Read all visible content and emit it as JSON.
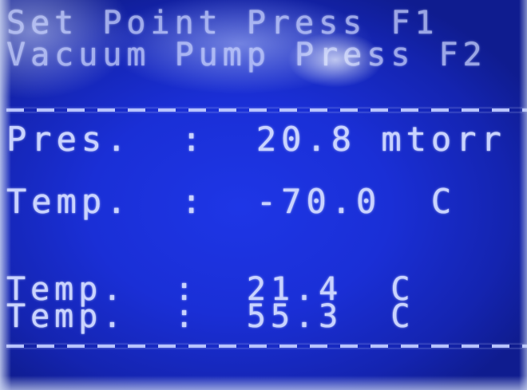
{
  "display": {
    "lines": [
      "Set Point Press F1",
      "Vacuum Pump Press F2"
    ],
    "pressure": {
      "label": "Pres.",
      "separator": ":",
      "value": "20.8",
      "unit": "mtorr"
    },
    "temp_1": {
      "label": "Temp.",
      "separator": ":",
      "value": "-70.0",
      "unit": "C"
    },
    "temp_2": {
      "label": "Temp.",
      "separator": ":",
      "value": "21.4",
      "unit": "C"
    },
    "temp_3": {
      "label": "Temp.",
      "separator": ":",
      "value": "55.3",
      "unit": "C"
    }
  },
  "colors": {
    "screen_blue": "#1a2fd6",
    "segment_text": "#c9d3ff"
  }
}
